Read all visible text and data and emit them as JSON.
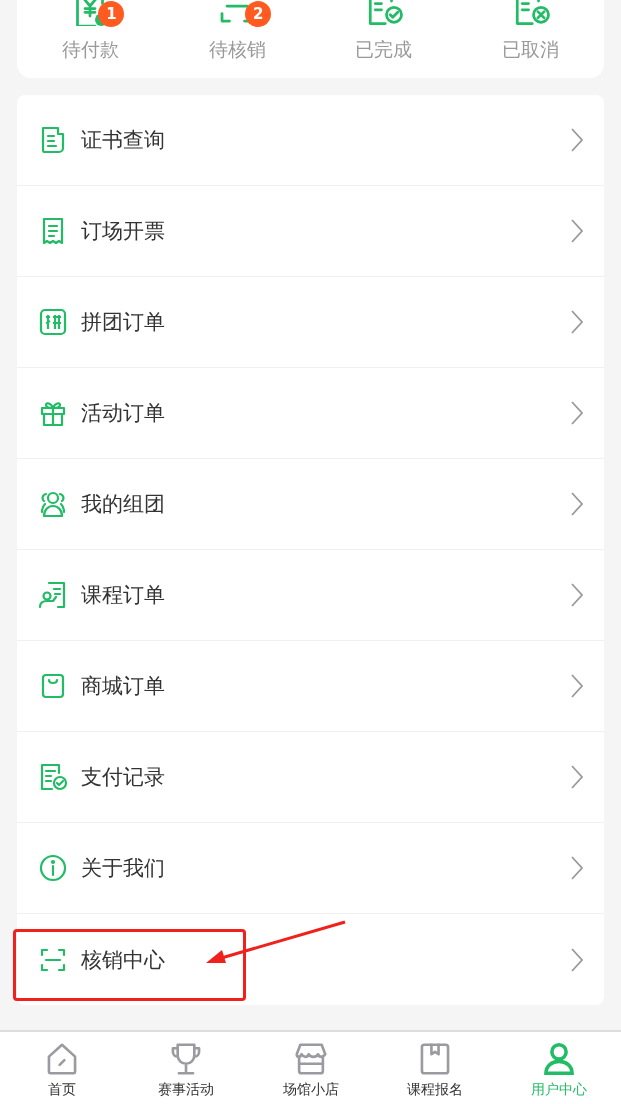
{
  "order_status": [
    {
      "label": "待付款",
      "badge": "1"
    },
    {
      "label": "待核销",
      "badge": "2"
    },
    {
      "label": "已完成"
    },
    {
      "label": "已取消"
    }
  ],
  "menu": [
    {
      "label": "证书查询",
      "highlighted": false
    },
    {
      "label": "订场开票",
      "highlighted": false
    },
    {
      "label": "拼团订单",
      "highlighted": false
    },
    {
      "label": "活动订单",
      "highlighted": false
    },
    {
      "label": "我的组团",
      "highlighted": false
    },
    {
      "label": "课程订单",
      "highlighted": false
    },
    {
      "label": "商城订单",
      "highlighted": false
    },
    {
      "label": "支付记录",
      "highlighted": false
    },
    {
      "label": "关于我们",
      "highlighted": false
    },
    {
      "label": "核销中心",
      "highlighted": true
    }
  ],
  "tab_bar": [
    {
      "label": "首页",
      "selected": false
    },
    {
      "label": "赛事活动",
      "selected": false
    },
    {
      "label": "场馆小店",
      "selected": false
    },
    {
      "label": "课程报名",
      "selected": false
    },
    {
      "label": "用户中心",
      "selected": true
    }
  ]
}
